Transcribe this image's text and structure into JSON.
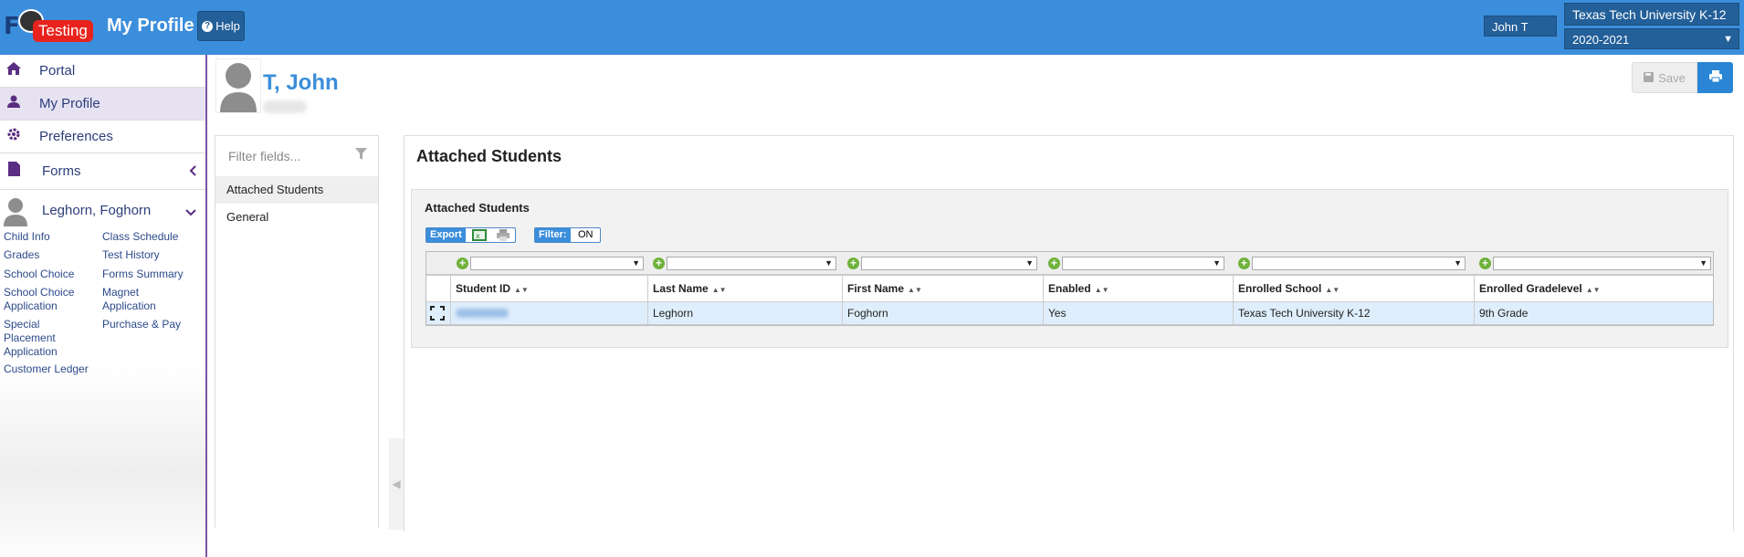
{
  "header": {
    "logo_text": "Testing",
    "app_title": "My Profile",
    "help_label": "Help",
    "user_name": "John T",
    "school": "Texas Tech University K-12",
    "year": "2020-2021"
  },
  "sidebar": {
    "items": [
      {
        "label": "Portal",
        "icon": "home-icon"
      },
      {
        "label": "My Profile",
        "icon": "user-icon"
      },
      {
        "label": "Preferences",
        "icon": "gear-icon"
      },
      {
        "label": "Forms",
        "icon": "document-icon"
      }
    ],
    "student": "Leghorn, Foghorn",
    "links": {
      "child_info": "Child Info",
      "grades": "Grades",
      "school_choice": "School Choice",
      "school_choice_application": "School Choice Application",
      "special_placement": "Special Placement Application",
      "customer_ledger": "Customer Ledger",
      "class_schedule": "Class Schedule",
      "test_history": "Test History",
      "forms_summary": "Forms Summary",
      "magnet_application": "Magnet Application",
      "purchase_pay": "Purchase & Pay"
    }
  },
  "profile": {
    "name": "T, John",
    "save_label": "Save"
  },
  "fields_panel": {
    "filter_placeholder": "Filter fields...",
    "items": [
      "Attached Students",
      "General"
    ]
  },
  "main": {
    "title": "Attached Students",
    "section_title": "Attached Students",
    "export_label": "Export",
    "filter_label": "Filter:",
    "filter_state": "ON",
    "columns": [
      "Student ID",
      "Last Name",
      "First Name",
      "Enabled",
      "Enrolled School",
      "Enrolled Gradelevel"
    ],
    "rows": [
      {
        "last_name": "Leghorn",
        "first_name": "Foghorn",
        "enabled": "Yes",
        "school": "Texas Tech University K-12",
        "gradelevel": "9th Grade"
      }
    ]
  },
  "colors": {
    "topbar": "#3b8edb",
    "accent_purple": "#5a2d82",
    "link": "#2c3e7a"
  }
}
